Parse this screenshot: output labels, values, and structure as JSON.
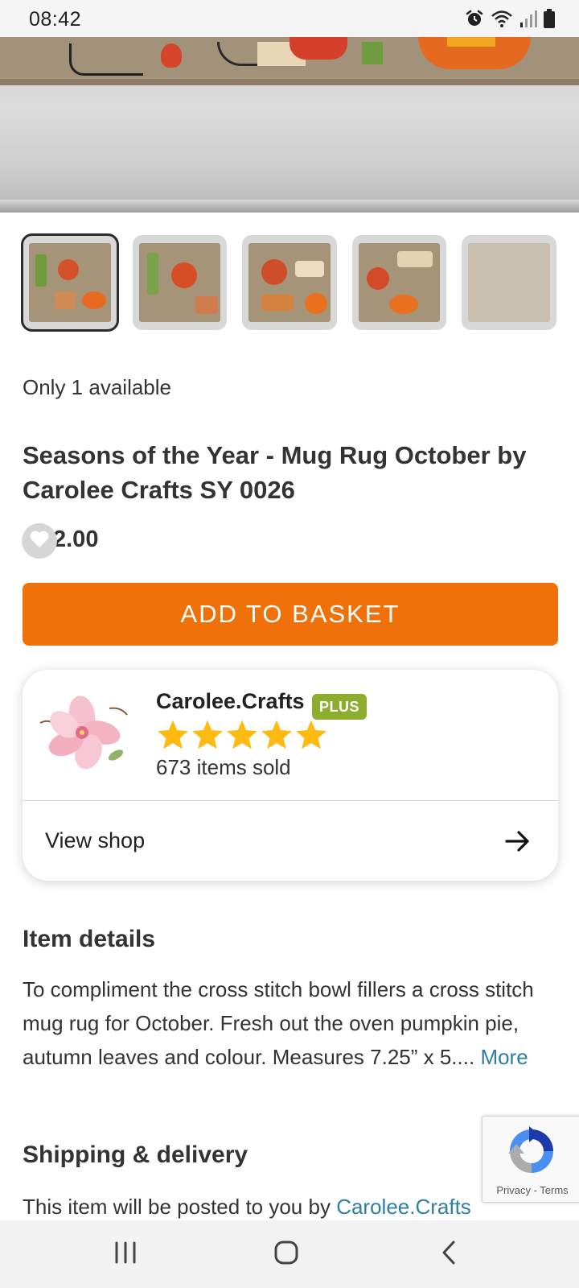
{
  "status_bar": {
    "time": "08:42",
    "icons": [
      "alarm-icon",
      "wifi-icon",
      "signal-icon",
      "battery-icon"
    ]
  },
  "product": {
    "availability": "Only 1 available",
    "title": "Seasons of the Year - Mug Rug October by Carolee Crafts SY 0026",
    "price": "£12.00",
    "price_visible": "2.00",
    "thumbnail_count": 5,
    "selected_thumbnail": 1
  },
  "actions": {
    "add_to_basket": "ADD TO BASKET"
  },
  "shop": {
    "name": "Carolee.Crafts",
    "badge": "PLUS",
    "rating": 5,
    "rating_max": 5,
    "items_sold": "673 items sold",
    "view_shop": "View shop"
  },
  "details": {
    "heading": "Item details",
    "text": "To compliment the cross stitch bowl fillers a cross stitch mug rug for October. Fresh out the oven pumpkin pie, autumn leaves and colour. Measures 7.25” x 5....",
    "more": "More"
  },
  "shipping": {
    "heading": "Shipping & delivery",
    "text": "This item will be posted to you by ",
    "link": "Carolee.Crafts"
  },
  "recaptcha": {
    "privacy": "Privacy",
    "separator": " - ",
    "terms": "Terms"
  },
  "colors": {
    "accent": "#f07109",
    "badge": "#8dad2f",
    "link": "#2e7ea6",
    "star": "#fdbb12"
  }
}
